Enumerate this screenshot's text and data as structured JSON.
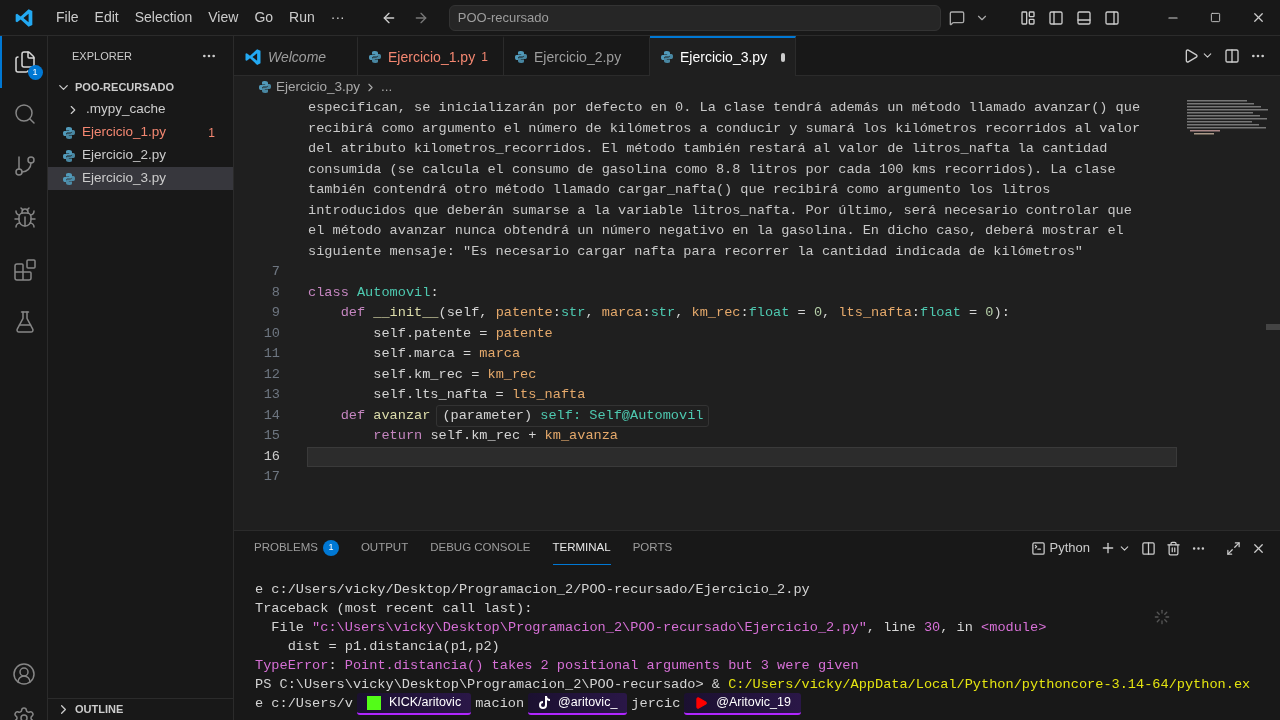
{
  "title_bar": {
    "menu": [
      "File",
      "Edit",
      "Selection",
      "View",
      "Go",
      "Run",
      "···"
    ],
    "search": "POO-recursado"
  },
  "activity_bar": {
    "items": [
      {
        "kind": "explorer",
        "selected": true,
        "badge": "1"
      },
      {
        "kind": "search",
        "selected": false
      },
      {
        "kind": "source-control",
        "selected": false
      },
      {
        "kind": "run",
        "selected": false
      },
      {
        "kind": "extensions",
        "selected": false
      },
      {
        "kind": "testing",
        "selected": false
      }
    ]
  },
  "sidebar": {
    "title": "EXPLORER",
    "folder": {
      "name": "POO-RECURSADO",
      "expanded": true
    },
    "items": [
      {
        "kind": "folder",
        "name": ".mypy_cache",
        "expanded": false,
        "selected": false,
        "error": false
      },
      {
        "kind": "python",
        "name": "Ejercicio_1.py",
        "error": true,
        "count": "1",
        "selected": false
      },
      {
        "kind": "python",
        "name": "Ejercicio_2.py",
        "error": false,
        "selected": false
      },
      {
        "kind": "python",
        "name": "Ejercicio_3.py",
        "error": false,
        "selected": true
      }
    ],
    "outline": {
      "title": "OUTLINE",
      "expanded": false
    }
  },
  "tabs": [
    {
      "kind": "welcome",
      "label": "Welcome",
      "selected": false,
      "error": false,
      "modified": false
    },
    {
      "kind": "python",
      "label": "Ejercicio_1.py",
      "count": "1",
      "selected": false,
      "error": true,
      "modified": false
    },
    {
      "kind": "python",
      "label": "Ejercicio_2.py",
      "selected": false,
      "error": false,
      "modified": false
    },
    {
      "kind": "python",
      "label": "Ejercicio_3.py",
      "selected": true,
      "error": false,
      "modified": true
    }
  ],
  "breadcrumb": [
    "Ejercicio_3.py",
    "..."
  ],
  "code_lines": [
    {
      "current": false,
      "tokens": [
        {
          "kind": "doc",
          "text": "especifican, se inicializarán por defecto en 0. La clase tendrá además un método llamado avanzar() que"
        }
      ]
    },
    {
      "current": false,
      "tokens": [
        {
          "kind": "doc",
          "text": "recibirá como argumento el número de kilómetros a conducir y sumará los kilómetros recorridos al valor"
        }
      ]
    },
    {
      "current": false,
      "tokens": [
        {
          "kind": "doc",
          "text": "del atributo kilometros_recorridos. El método también restará al valor de litros_nafta la cantidad"
        }
      ]
    },
    {
      "current": false,
      "tokens": [
        {
          "kind": "doc",
          "text": "consumida (se calcula el consumo de gasolina como 8.8 litros por cada 100 kms recorridos). La clase"
        }
      ]
    },
    {
      "current": false,
      "tokens": [
        {
          "kind": "doc",
          "text": "también contendrá otro método llamado cargar_nafta() que recibirá como argumento los litros"
        }
      ]
    },
    {
      "current": false,
      "tokens": [
        {
          "kind": "doc",
          "text": "introducidos que deberán sumarse a la variable litros_nafta. Por último, será necesario controlar que"
        }
      ]
    },
    {
      "current": false,
      "tokens": [
        {
          "kind": "doc",
          "text": "el método avanzar nunca obtendrá un número negativo en la gasolina. En dicho caso, deberá mostrar el"
        }
      ]
    },
    {
      "current": false,
      "tokens": [
        {
          "kind": "doc",
          "text": "siguiente mensaje: \"Es necesario cargar nafta para recorrer la cantidad indicada de kilómetros\""
        }
      ]
    },
    {
      "number": "7",
      "current": false
    },
    {
      "number": "8",
      "current": false,
      "tokens": [
        {
          "kind": "keyword",
          "text": "class"
        },
        {
          "kind": "class",
          "text": " Automovil"
        },
        {
          "kind": "plain",
          "text": ":"
        }
      ]
    },
    {
      "number": "9",
      "current": false,
      "tokens": [
        {
          "kind": "keyword",
          "text": "    def"
        },
        {
          "kind": "func",
          "text": " __init__"
        },
        {
          "kind": "plain",
          "text": "(self, "
        },
        {
          "kind": "param",
          "text": "patente"
        },
        {
          "kind": "plain",
          "text": ":"
        },
        {
          "kind": "type",
          "text": "str"
        },
        {
          "kind": "plain",
          "text": ", "
        },
        {
          "kind": "param",
          "text": "marca"
        },
        {
          "kind": "plain",
          "text": ":"
        },
        {
          "kind": "type",
          "text": "str"
        },
        {
          "kind": "plain",
          "text": ", "
        },
        {
          "kind": "param",
          "text": "km_rec"
        },
        {
          "kind": "plain",
          "text": ":"
        },
        {
          "kind": "type",
          "text": "float"
        },
        {
          "kind": "plain",
          "text": " = "
        },
        {
          "kind": "number",
          "text": "0"
        },
        {
          "kind": "plain",
          "text": ", "
        },
        {
          "kind": "param",
          "text": "lts_nafta"
        },
        {
          "kind": "plain",
          "text": ":"
        },
        {
          "kind": "type",
          "text": "float"
        },
        {
          "kind": "plain",
          "text": " = "
        },
        {
          "kind": "number",
          "text": "0"
        },
        {
          "kind": "plain",
          "text": "):"
        }
      ]
    },
    {
      "number": "10",
      "current": false,
      "tokens": [
        {
          "kind": "plain",
          "text": "        self.patente = "
        },
        {
          "kind": "param",
          "text": "patente"
        }
      ]
    },
    {
      "number": "11",
      "current": false,
      "tokens": [
        {
          "kind": "plain",
          "text": "        self.marca = "
        },
        {
          "kind": "param",
          "text": "marca"
        }
      ]
    },
    {
      "number": "12",
      "current": false,
      "tokens": [
        {
          "kind": "plain",
          "text": "        self.km_rec = "
        },
        {
          "kind": "param",
          "text": "km_rec"
        }
      ]
    },
    {
      "number": "13",
      "current": false,
      "tokens": [
        {
          "kind": "plain",
          "text": "        self.lts_nafta = "
        },
        {
          "kind": "param",
          "text": "lts_nafta"
        }
      ]
    },
    {
      "number": "14",
      "current": false,
      "hover": true,
      "tokens": [
        {
          "kind": "keyword",
          "text": "    def"
        },
        {
          "kind": "func",
          "text": " avanzar"
        }
      ]
    },
    {
      "number": "15",
      "current": false,
      "tokens": [
        {
          "kind": "keyword",
          "text": "        return"
        },
        {
          "kind": "plain",
          "text": " self.km_rec + "
        },
        {
          "kind": "param",
          "text": "km_avanza"
        }
      ]
    },
    {
      "number": "16",
      "current": true
    },
    {
      "number": "17",
      "current": false
    }
  ],
  "hover": [
    {
      "kind": "plain",
      "text": "(parameter) "
    },
    {
      "kind": "name",
      "text": "self: "
    },
    {
      "kind": "class",
      "text": "Self@Automovil"
    }
  ],
  "panel": {
    "tabs": [
      {
        "label": "PROBLEMS",
        "badge": "1",
        "selected": false
      },
      {
        "label": "OUTPUT",
        "selected": false
      },
      {
        "label": "DEBUG CONSOLE",
        "selected": false
      },
      {
        "label": "TERMINAL",
        "selected": true
      },
      {
        "label": "PORTS",
        "selected": false
      }
    ],
    "profile": "Python",
    "lines": [
      [
        {
          "kind": "plain",
          "text": "e c:/Users/vicky/Desktop/Programacion_2/POO-recursado/Ejercicio_2.py"
        }
      ],
      [
        {
          "kind": "plain",
          "text": "Traceback (most recent call last):"
        }
      ],
      [
        {
          "kind": "plain",
          "text": "  File "
        },
        {
          "kind": "magenta",
          "text": "\"c:\\Users\\vicky\\Desktop\\Programacion_2\\POO-recursado\\Ejercicio_2.py\""
        },
        {
          "kind": "plain",
          "text": ", line "
        },
        {
          "kind": "magenta",
          "text": "30"
        },
        {
          "kind": "plain",
          "text": ", in "
        },
        {
          "kind": "magenta",
          "text": "<module>"
        }
      ],
      [
        {
          "kind": "plain",
          "text": "    dist = p1.distancia(p1,p2)"
        }
      ],
      [
        {
          "kind": "magenta",
          "text": "TypeError"
        },
        {
          "kind": "plain",
          "text": ": "
        },
        {
          "kind": "magenta",
          "text": "Point.distancia() takes 2 positional arguments but 3 were given"
        }
      ],
      [
        {
          "kind": "plain",
          "text": "PS C:\\Users\\vicky\\Desktop\\Programacion_2\\POO-recursado> & "
        },
        {
          "kind": "yellow",
          "text": "C:/Users/vicky/AppData/Local/Python/pythoncore-3.14-64/python.ex"
        }
      ]
    ],
    "last_line": [
      "e c:/Users/v",
      "macion",
      "jercic"
    ]
  },
  "overlay": [
    {
      "kind": "kick",
      "label": "KICK/aritovic"
    },
    {
      "kind": "tiktok",
      "label": "@aritovic_"
    },
    {
      "kind": "youtube",
      "label": "@Aritovic_19"
    }
  ]
}
